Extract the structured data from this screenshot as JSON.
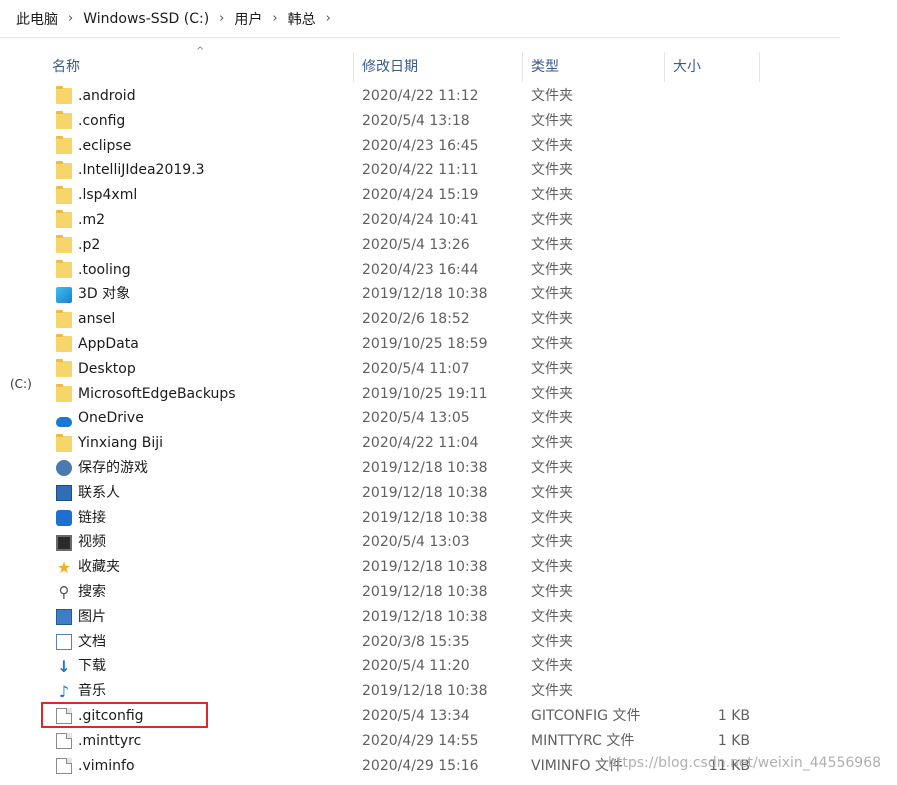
{
  "breadcrumb": [
    "此电脑",
    "Windows-SSD (C:)",
    "用户",
    "韩总"
  ],
  "nav_label": "(C:)",
  "columns": {
    "name": "名称",
    "date": "修改日期",
    "type": "类型",
    "size": "大小"
  },
  "rows": [
    {
      "name": ".android",
      "date": "2020/4/22 11:12",
      "type": "文件夹",
      "size": "",
      "icon": "folder-icon"
    },
    {
      "name": ".config",
      "date": "2020/5/4 13:18",
      "type": "文件夹",
      "size": "",
      "icon": "folder-icon"
    },
    {
      "name": ".eclipse",
      "date": "2020/4/23 16:45",
      "type": "文件夹",
      "size": "",
      "icon": "folder-icon"
    },
    {
      "name": ".IntelliJIdea2019.3",
      "date": "2020/4/22 11:11",
      "type": "文件夹",
      "size": "",
      "icon": "folder-icon"
    },
    {
      "name": ".lsp4xml",
      "date": "2020/4/24 15:19",
      "type": "文件夹",
      "size": "",
      "icon": "folder-icon"
    },
    {
      "name": ".m2",
      "date": "2020/4/24 10:41",
      "type": "文件夹",
      "size": "",
      "icon": "folder-icon"
    },
    {
      "name": ".p2",
      "date": "2020/5/4 13:26",
      "type": "文件夹",
      "size": "",
      "icon": "folder-icon"
    },
    {
      "name": ".tooling",
      "date": "2020/4/23 16:44",
      "type": "文件夹",
      "size": "",
      "icon": "folder-icon"
    },
    {
      "name": "3D 对象",
      "date": "2019/12/18 10:38",
      "type": "文件夹",
      "size": "",
      "icon": "3d-objects-icon"
    },
    {
      "name": "ansel",
      "date": "2020/2/6 18:52",
      "type": "文件夹",
      "size": "",
      "icon": "folder-icon"
    },
    {
      "name": "AppData",
      "date": "2019/10/25 18:59",
      "type": "文件夹",
      "size": "",
      "icon": "folder-icon"
    },
    {
      "name": "Desktop",
      "date": "2020/5/4 11:07",
      "type": "文件夹",
      "size": "",
      "icon": "folder-icon"
    },
    {
      "name": "MicrosoftEdgeBackups",
      "date": "2019/10/25 19:11",
      "type": "文件夹",
      "size": "",
      "icon": "folder-icon"
    },
    {
      "name": "OneDrive",
      "date": "2020/5/4 13:05",
      "type": "文件夹",
      "size": "",
      "icon": "onedrive-icon"
    },
    {
      "name": "Yinxiang Biji",
      "date": "2020/4/22 11:04",
      "type": "文件夹",
      "size": "",
      "icon": "folder-icon"
    },
    {
      "name": "保存的游戏",
      "date": "2019/12/18 10:38",
      "type": "文件夹",
      "size": "",
      "icon": "saved-games-icon"
    },
    {
      "name": "联系人",
      "date": "2019/12/18 10:38",
      "type": "文件夹",
      "size": "",
      "icon": "contacts-icon"
    },
    {
      "name": "链接",
      "date": "2019/12/18 10:38",
      "type": "文件夹",
      "size": "",
      "icon": "links-icon"
    },
    {
      "name": "视频",
      "date": "2020/5/4 13:03",
      "type": "文件夹",
      "size": "",
      "icon": "videos-icon"
    },
    {
      "name": "收藏夹",
      "date": "2019/12/18 10:38",
      "type": "文件夹",
      "size": "",
      "icon": "favorites-icon"
    },
    {
      "name": "搜索",
      "date": "2019/12/18 10:38",
      "type": "文件夹",
      "size": "",
      "icon": "searches-icon"
    },
    {
      "name": "图片",
      "date": "2019/12/18 10:38",
      "type": "文件夹",
      "size": "",
      "icon": "pictures-icon"
    },
    {
      "name": "文档",
      "date": "2020/3/8 15:35",
      "type": "文件夹",
      "size": "",
      "icon": "documents-icon"
    },
    {
      "name": "下载",
      "date": "2020/5/4 11:20",
      "type": "文件夹",
      "size": "",
      "icon": "downloads-icon"
    },
    {
      "name": "音乐",
      "date": "2019/12/18 10:38",
      "type": "文件夹",
      "size": "",
      "icon": "music-icon"
    },
    {
      "name": ".gitconfig",
      "date": "2020/5/4 13:34",
      "type": "GITCONFIG 文件",
      "size": "1 KB",
      "icon": "file-icon"
    },
    {
      "name": ".minttyrc",
      "date": "2020/4/29 14:55",
      "type": "MINTTYRC 文件",
      "size": "1 KB",
      "icon": "file-icon"
    },
    {
      "name": ".viminfo",
      "date": "2020/4/29 15:16",
      "type": "VIMINFO 文件",
      "size": "11 KB",
      "icon": "file-icon"
    }
  ],
  "watermark": "https://blog.csdn.net/weixin_44556968"
}
